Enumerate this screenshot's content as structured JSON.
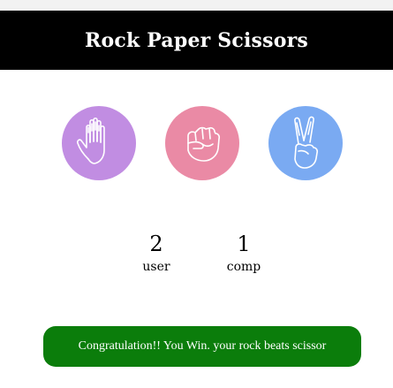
{
  "header": {
    "title": "Rock Paper Scissors"
  },
  "choices": [
    {
      "id": "paper",
      "icon": "open-hand-icon",
      "color": "#c18de2"
    },
    {
      "id": "rock",
      "icon": "fist-icon",
      "color": "#ea8aa5"
    },
    {
      "id": "scissor",
      "icon": "victory-hand-icon",
      "color": "#7aaaf2"
    }
  ],
  "score": {
    "user": {
      "value": "2",
      "label": "user"
    },
    "comp": {
      "value": "1",
      "label": "comp"
    }
  },
  "message": {
    "text": "Congratulation!! You Win. your rock beats scissor",
    "color": "#0b7d0b"
  }
}
